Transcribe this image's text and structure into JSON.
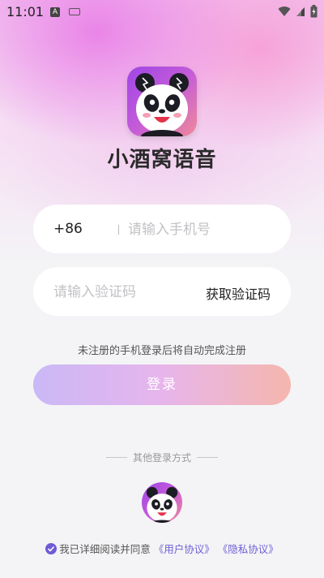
{
  "status_bar": {
    "time": "11:01",
    "left_icons": [
      "a-badge-icon",
      "keyboard-icon"
    ],
    "right_icons": [
      "wifi-icon",
      "signal-icon",
      "battery-icon"
    ]
  },
  "app": {
    "name": "小酒窝语音",
    "logo": "panda-logo-icon"
  },
  "phone_field": {
    "country_code": "+86",
    "placeholder": "请输入手机号",
    "value": ""
  },
  "code_field": {
    "placeholder": "请输入验证码",
    "value": "",
    "get_code_label": "获取验证码"
  },
  "hint": "未注册的手机登录后将自动完成注册",
  "login_button": "登录",
  "other_login": {
    "label": "其他登录方式",
    "option": "panda-quick-login-icon"
  },
  "agreement": {
    "prefix": "我已详细阅读并同意",
    "user_agreement": "《用户协议》",
    "privacy_policy": "《隐私协议》"
  },
  "colors": {
    "accent": "#6c5fd4",
    "login_gradient_start": "#cab8f6",
    "login_gradient_end": "#f5b6ad",
    "logo_gradient_start": "#9f46e6",
    "logo_gradient_end": "#f08a98"
  }
}
